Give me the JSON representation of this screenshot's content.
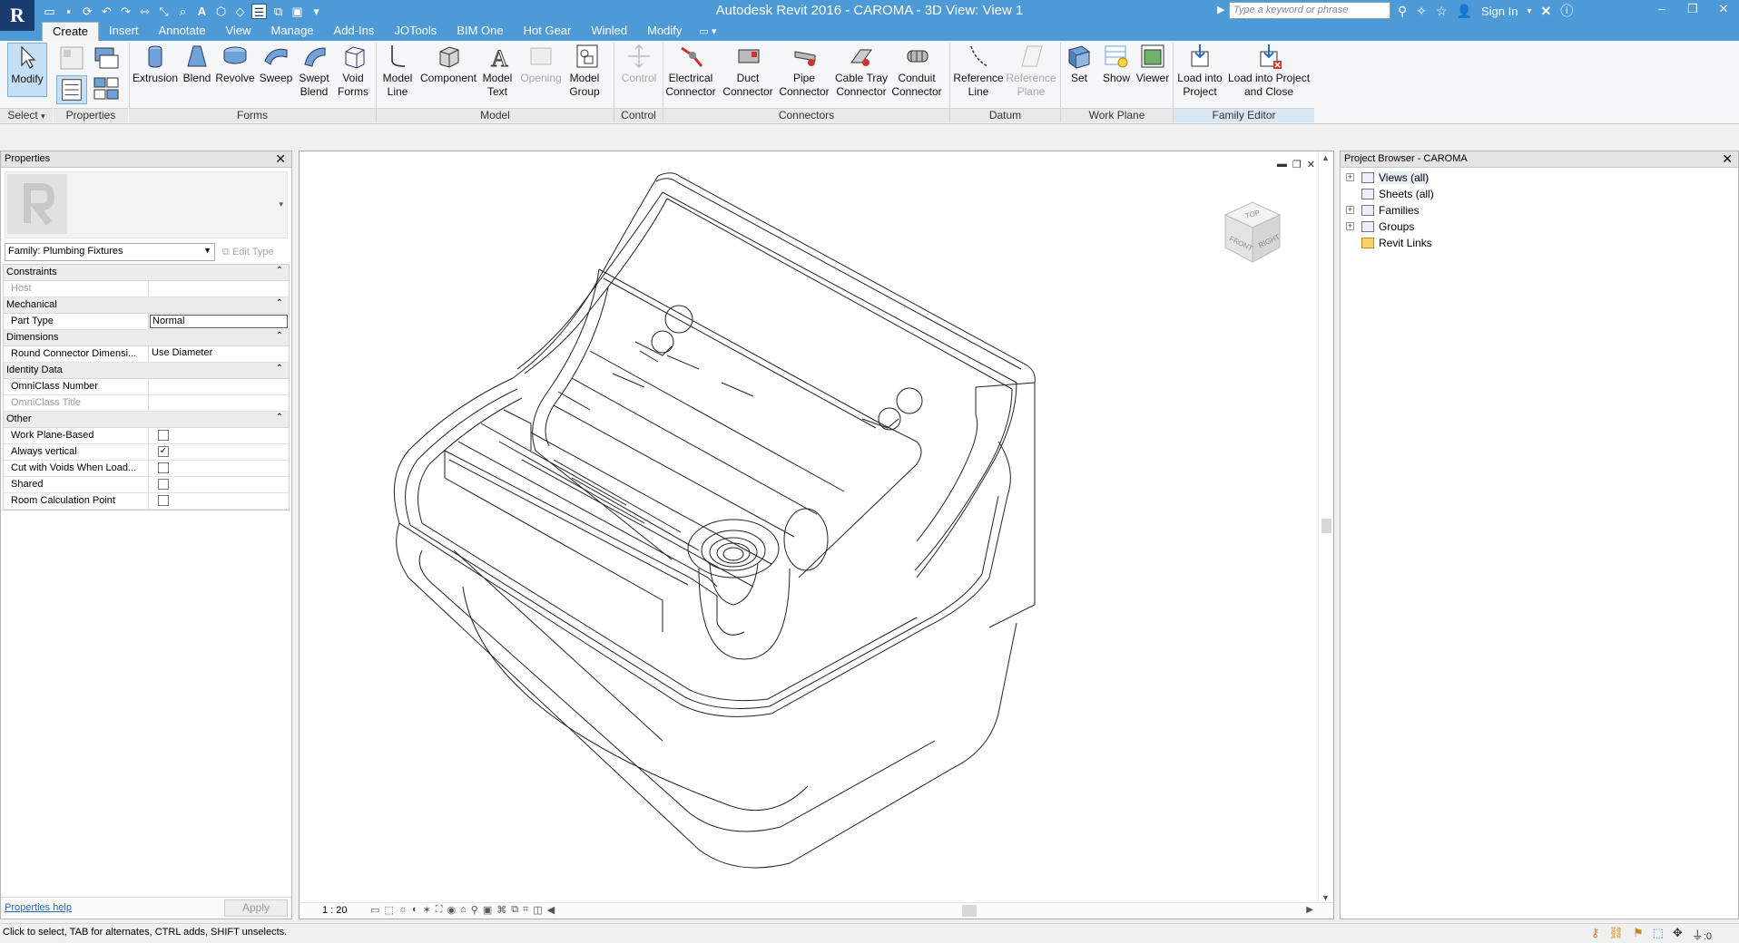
{
  "app": {
    "window_title": "Autodesk Revit 2016 -    CAROMA - 3D View: View 1",
    "search_placeholder": "Type a keyword or phrase",
    "sign_in_label": "Sign In"
  },
  "tabs": [
    {
      "label": "Create",
      "active": true
    },
    {
      "label": "Insert"
    },
    {
      "label": "Annotate"
    },
    {
      "label": "View"
    },
    {
      "label": "Manage"
    },
    {
      "label": "Add-Ins"
    },
    {
      "label": "JOTools"
    },
    {
      "label": "BIM One"
    },
    {
      "label": "Hot Gear"
    },
    {
      "label": "Winled"
    },
    {
      "label": "Modify"
    }
  ],
  "ribbon": {
    "buttons": {
      "modify": "Modify",
      "extrusion": "Extrusion",
      "blend": "Blend",
      "revolve": "Revolve",
      "sweep": "Sweep",
      "swept_blend": "Swept Blend",
      "void_forms": "Void Forms",
      "model_line": "Model Line",
      "component": "Component",
      "model_text": "Model Text",
      "opening": "Opening",
      "model_group": "Model Group",
      "control": "Control",
      "electrical_connector": "Electrical Connector",
      "duct_connector": "Duct Connector",
      "pipe_connector": "Pipe Connector",
      "cable_tray_connector": "Cable Tray Connector",
      "conduit_connector": "Conduit Connector",
      "reference_line": "Reference Line",
      "reference_plane": "Reference Plane",
      "set": "Set",
      "show": "Show",
      "viewer": "Viewer",
      "load_into_project": "Load into Project",
      "load_into_project_close": "Load into Project and Close"
    },
    "panels": {
      "select": "Select",
      "properties": "Properties",
      "forms": "Forms",
      "model": "Model",
      "control": "Control",
      "connectors": "Connectors",
      "datum": "Datum",
      "work_plane": "Work Plane",
      "family_editor": "Family Editor"
    }
  },
  "properties": {
    "title": "Properties",
    "family_selector": "Family: Plumbing Fixtures",
    "edit_type": "Edit Type",
    "groups": [
      {
        "name": "Constraints",
        "rows": [
          {
            "key": "Host",
            "value": "",
            "dim": true
          }
        ]
      },
      {
        "name": "Mechanical",
        "rows": [
          {
            "key": "Part Type",
            "value": "Normal",
            "editing": true
          }
        ]
      },
      {
        "name": "Dimensions",
        "rows": [
          {
            "key": "Round Connector Dimensi...",
            "value": "Use Diameter"
          }
        ]
      },
      {
        "name": "Identity Data",
        "rows": [
          {
            "key": "OmniClass Number",
            "value": ""
          },
          {
            "key": "OmniClass Title",
            "value": "",
            "dim": true
          }
        ]
      },
      {
        "name": "Other",
        "rows": [
          {
            "key": "Work Plane-Based",
            "checkbox": true,
            "checked": false
          },
          {
            "key": "Always vertical",
            "checkbox": true,
            "checked": true
          },
          {
            "key": "Cut with Voids When Load...",
            "checkbox": true,
            "checked": false
          },
          {
            "key": "Shared",
            "checkbox": true,
            "checked": false
          },
          {
            "key": "Room Calculation Point",
            "checkbox": true,
            "checked": false
          }
        ]
      }
    ],
    "help_link": "Properties help",
    "apply_label": "Apply"
  },
  "view": {
    "scale": "1 : 20",
    "viewcube_faces": {
      "top": "TOP",
      "front": "FRONT",
      "right": "RIGHT"
    }
  },
  "browser": {
    "title": "Project Browser - CAROMA",
    "items": [
      {
        "label": "Views (all)",
        "expandable": true,
        "selected": true
      },
      {
        "label": "Sheets (all)",
        "expandable": false
      },
      {
        "label": "Families",
        "expandable": true
      },
      {
        "label": "Groups",
        "expandable": true
      },
      {
        "label": "Revit Links",
        "expandable": false
      }
    ]
  },
  "status": {
    "message": "Click to select, TAB for alternates, CTRL adds, SHIFT unselects.",
    "filter_count": ":0"
  }
}
